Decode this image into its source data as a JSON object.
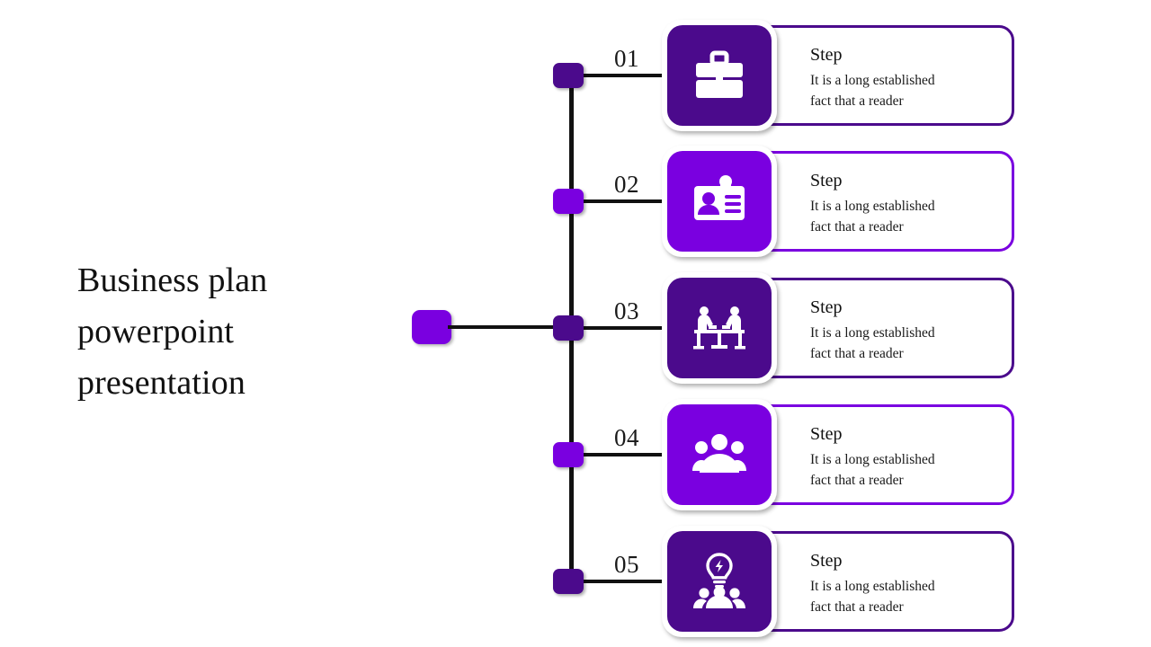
{
  "slide": {
    "background": "#ffffff",
    "title": "Business plan powerpoint presentation",
    "title_lines": [
      "Business plan",
      "powerpoint",
      "presentation"
    ]
  },
  "colors": {
    "dark_purple": "#4b0a8c",
    "bright_purple": "#7a00e0",
    "line": "#111111",
    "text": "#111111",
    "card_background": "#ffffff"
  },
  "diagram": {
    "type": "vertical-timeline",
    "anchor_label": "",
    "anchor_color": "#7a00e0",
    "steps": [
      {
        "number": "01",
        "title": "Step",
        "body_lines": [
          "It is a long established",
          "fact that a reader"
        ],
        "body": "It is a long established fact that a reader",
        "color": "#4b0a8c",
        "icon": "briefcase-icon"
      },
      {
        "number": "02",
        "title": "Step",
        "body_lines": [
          "It is a long established",
          "fact that a reader"
        ],
        "body": "It is a long established fact that a reader",
        "color": "#7a00e0",
        "icon": "id-card-icon"
      },
      {
        "number": "03",
        "title": "Step",
        "body_lines": [
          "It is a long established",
          "fact that a reader"
        ],
        "body": "It is a long established fact that a reader",
        "color": "#4b0a8c",
        "icon": "meeting-table-icon"
      },
      {
        "number": "04",
        "title": "Step",
        "body_lines": [
          "It is a long established",
          "fact that a reader"
        ],
        "body": "It is a long established fact that a reader",
        "color": "#7a00e0",
        "icon": "team-group-icon"
      },
      {
        "number": "05",
        "title": "Step",
        "body_lines": [
          "It is a long established",
          "fact that a reader"
        ],
        "body": "It is a long established fact that a reader",
        "color": "#4b0a8c",
        "icon": "team-idea-bulb-icon"
      }
    ]
  }
}
